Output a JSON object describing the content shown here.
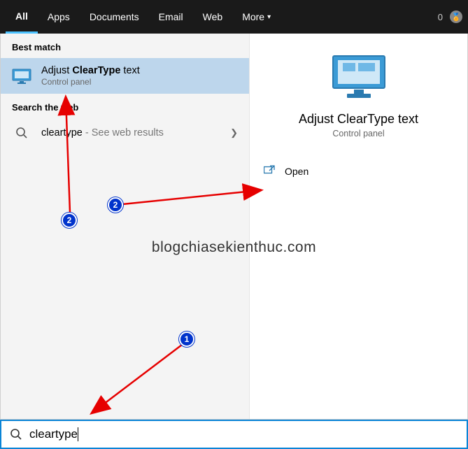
{
  "topbar": {
    "tabs": [
      "All",
      "Apps",
      "Documents",
      "Email",
      "Web",
      "More"
    ],
    "count": "0"
  },
  "left": {
    "best_match_label": "Best match",
    "result": {
      "title_pre": "Adjust ",
      "title_bold": "ClearType",
      "title_post": " text",
      "subtitle": "Control panel"
    },
    "web_label": "Search the web",
    "web_result": {
      "query": "cleartype",
      "suffix": " - See web results"
    }
  },
  "right": {
    "title": "Adjust ClearType text",
    "subtitle": "Control panel",
    "open": "Open"
  },
  "search": {
    "value": "cleartype"
  },
  "watermark": "blogchiasekienthuc.com",
  "badges": {
    "b1": "1",
    "b2a": "2",
    "b2b": "2"
  }
}
